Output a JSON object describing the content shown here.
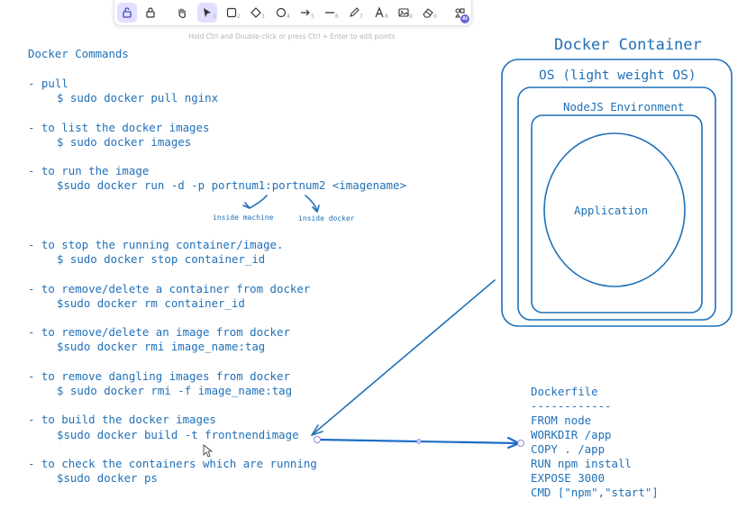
{
  "toolbar": {
    "items": [
      {
        "icon": "lock-icon",
        "key": ""
      },
      {
        "icon": "hand-icon",
        "key": ""
      },
      {
        "icon": "selection-icon",
        "key": "1"
      },
      {
        "icon": "rectangle-icon",
        "key": "2"
      },
      {
        "icon": "diamond-icon",
        "key": "3"
      },
      {
        "icon": "ellipse-icon",
        "key": "4"
      },
      {
        "icon": "arrow-icon",
        "key": "5"
      },
      {
        "icon": "line-icon",
        "key": "6"
      },
      {
        "icon": "pencil-icon",
        "key": "7"
      },
      {
        "icon": "text-icon",
        "key": "8"
      },
      {
        "icon": "image-icon",
        "key": "9"
      },
      {
        "icon": "eraser-icon",
        "key": "0"
      },
      {
        "icon": "more-tools-icon",
        "key": ""
      }
    ],
    "ai_badge": "AI",
    "accent": "#6965db"
  },
  "hint": "Hold Ctrl and Double-click or press Ctrl + Enter to edit points",
  "ink_color": "#1f70b8",
  "commands": {
    "title": "Docker Commands",
    "pull_label": "- pull",
    "pull_cmd": "$ sudo docker pull nginx",
    "list_label": "- to list the docker images",
    "list_cmd": "$ sudo docker images",
    "run_label": "- to run the image",
    "run_cmd": "$sudo docker run -d -p portnum1:portnum2 <imagename>",
    "run_note1": "inside machine",
    "run_note2": "inside docker",
    "stop_label": "- to stop the running container/image.",
    "stop_cmd": "$ sudo docker stop container_id",
    "rm_label": "- to remove/delete a container from docker",
    "rm_cmd": "$sudo docker rm container_id",
    "rmi_label": "- to remove/delete an image from docker",
    "rmi_cmd": "$sudo docker rmi image_name:tag",
    "dangling_label": "- to remove dangling images from docker",
    "dangling_cmd": "$ sudo docker rmi -f image_name:tag",
    "build_label": "- to build the docker images",
    "build_cmd": "$sudo docker build -t frontnendimage",
    "ps_label": "- to check the containers which are running",
    "ps_cmd": "$sudo docker ps"
  },
  "diagram": {
    "container_title": "Docker Container",
    "os_label": "OS (light weight OS)",
    "node_label": "NodeJS Environment",
    "app_label": "Application"
  },
  "dockerfile": {
    "title": "Dockerfile",
    "rule": "------------",
    "lines": [
      "FROM node",
      "WORKDIR /app",
      "COPY . /app",
      "RUN npm install",
      "EXPOSE 3000",
      "CMD [\"npm\",\"start\"]"
    ]
  }
}
